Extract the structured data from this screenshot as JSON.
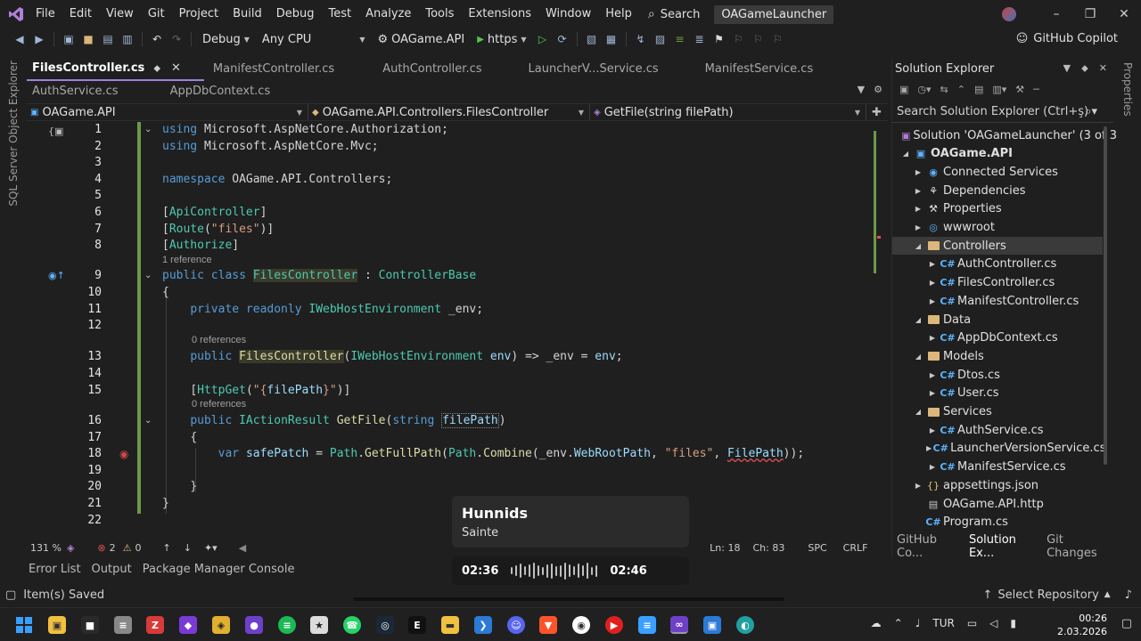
{
  "menu": {
    "items": [
      "File",
      "Edit",
      "View",
      "Git",
      "Project",
      "Build",
      "Debug",
      "Test",
      "Analyze",
      "Tools",
      "Extensions",
      "Window",
      "Help"
    ],
    "search_label": "Search",
    "solution_name": "OAGameLauncher"
  },
  "toolbar": {
    "config": "Debug",
    "platform": "Any CPU",
    "startup_project": "OAGame.API",
    "profile": "https",
    "copilot_label": "GitHub Copilot"
  },
  "left_strip": {
    "label": "SQL Server Object Explorer"
  },
  "right_strip": {
    "label": "Properties"
  },
  "tabs": {
    "row1": [
      {
        "label": "FilesController.cs",
        "active": true
      },
      {
        "label": "ManifestController.cs",
        "active": false
      },
      {
        "label": "AuthController.cs",
        "active": false
      },
      {
        "label": "LauncherV...Service.cs",
        "active": false
      },
      {
        "label": "ManifestService.cs",
        "active": false
      }
    ],
    "row2": [
      {
        "label": "AuthService.cs"
      },
      {
        "label": "AppDbContext.cs"
      }
    ]
  },
  "navbar": {
    "project": "OAGame.API",
    "class": "OAGame.API.Controllers.FilesController",
    "member": "GetFile(string filePath)"
  },
  "code": {
    "references": {
      "one": "1 reference",
      "zero": "0 references"
    },
    "line_numbers": [
      "1",
      "2",
      "3",
      "4",
      "5",
      "6",
      "7",
      "8",
      "9",
      "10",
      "11",
      "12",
      "13",
      "14",
      "15",
      "16",
      "17",
      "18",
      "19",
      "20",
      "21",
      "22"
    ]
  },
  "editor_status": {
    "zoom": "131 %",
    "errors": "2",
    "warnings": "0",
    "position_ln": "Ln: 18",
    "position_ch": "Ch: 83",
    "whitespace": "SPC",
    "line_ending": "CRLF"
  },
  "bottom_tabs": [
    "Error List",
    "Output",
    "Package Manager Console"
  ],
  "solution_explorer": {
    "title": "Solution Explorer",
    "search_placeholder": "Search Solution Explorer (Ctrl+ş)",
    "tree": [
      {
        "label": "Solution 'OAGameLauncher' (3 of 3",
        "icon": "solution",
        "level": 0,
        "twisty": ""
      },
      {
        "label": "OAGame.API",
        "icon": "csproj",
        "level": 0,
        "twisty": "open",
        "bold": true
      },
      {
        "label": "Connected Services",
        "icon": "connected",
        "level": 1,
        "twisty": "closed"
      },
      {
        "label": "Dependencies",
        "icon": "deps",
        "level": 1,
        "twisty": "closed"
      },
      {
        "label": "Properties",
        "icon": "wrench",
        "level": 1,
        "twisty": "closed"
      },
      {
        "label": "wwwroot",
        "icon": "globe",
        "level": 1,
        "twisty": "closed"
      },
      {
        "label": "Controllers",
        "icon": "folder",
        "level": 1,
        "twisty": "open",
        "selected": true
      },
      {
        "label": "AuthController.cs",
        "icon": "cs",
        "level": 2,
        "twisty": "closed"
      },
      {
        "label": "FilesController.cs",
        "icon": "cs",
        "level": 2,
        "twisty": "closed"
      },
      {
        "label": "ManifestController.cs",
        "icon": "cs",
        "level": 2,
        "twisty": "closed"
      },
      {
        "label": "Data",
        "icon": "folder",
        "level": 1,
        "twisty": "open"
      },
      {
        "label": "AppDbContext.cs",
        "icon": "cs",
        "level": 2,
        "twisty": "closed"
      },
      {
        "label": "Models",
        "icon": "folder",
        "level": 1,
        "twisty": "open"
      },
      {
        "label": "Dtos.cs",
        "icon": "cs",
        "level": 2,
        "twisty": "closed"
      },
      {
        "label": "User.cs",
        "icon": "cs",
        "level": 2,
        "twisty": "closed"
      },
      {
        "label": "Services",
        "icon": "folder",
        "level": 1,
        "twisty": "open"
      },
      {
        "label": "AuthService.cs",
        "icon": "cs",
        "level": 2,
        "twisty": "closed"
      },
      {
        "label": "LauncherVersionService.cs",
        "icon": "cs",
        "level": 2,
        "twisty": "closed"
      },
      {
        "label": "ManifestService.cs",
        "icon": "cs",
        "level": 2,
        "twisty": "closed"
      },
      {
        "label": "appsettings.json",
        "icon": "json",
        "level": 1,
        "twisty": "closed"
      },
      {
        "label": "OAGame.API.http",
        "icon": "http",
        "level": 1,
        "twisty": ""
      },
      {
        "label": "Program.cs",
        "icon": "cs",
        "level": 1,
        "twisty": ""
      }
    ],
    "bottom_tabs": [
      "GitHub Co...",
      "Solution Ex...",
      "Git Changes"
    ]
  },
  "status_bar": {
    "message": "Item(s) Saved",
    "repo": "Select Repository"
  },
  "media": {
    "title": "Hunnids",
    "artist": "Sainte",
    "elapsed": "02:36",
    "duration": "02:46"
  },
  "taskbar": {
    "language": "TUR",
    "time": "00:26",
    "date": "2.03.2026"
  },
  "colors": {
    "keyword": "#569cd6",
    "type": "#4ec9b0",
    "method": "#dcdcaa",
    "string": "#d69d85",
    "accent": "#a07ee0",
    "background": "#1f1f1f"
  }
}
